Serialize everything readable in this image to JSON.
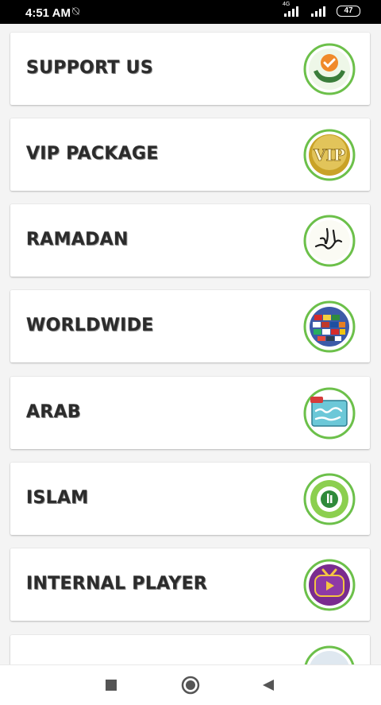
{
  "status_bar": {
    "time": "4:51 AM",
    "network_tag": "4G",
    "battery": "47"
  },
  "menu": {
    "items": [
      {
        "label": "SUPPORT US",
        "icon": "support-check-hands-icon"
      },
      {
        "label": "VIP PACKAGE",
        "icon": "vip-gold-icon"
      },
      {
        "label": "RAMADAN",
        "icon": "ramadan-calligraphy-icon"
      },
      {
        "label": "WORLDWIDE",
        "icon": "world-flags-icon"
      },
      {
        "label": "ARAB",
        "icon": "arab-live-tv-icon"
      },
      {
        "label": "ISLAM",
        "icon": "islam-icon"
      },
      {
        "label": "INTERNAL PLAYER",
        "icon": "tv-play-icon"
      },
      {
        "label": "",
        "icon": "partial-icon"
      }
    ]
  },
  "nav_bar": {
    "buttons": [
      "recents-square-icon",
      "home-circle-icon",
      "back-triangle-icon"
    ]
  },
  "colors": {
    "accent_green": "#6cc04a",
    "status_bar_bg": "#000000",
    "vip_gold": "#c9a227",
    "player_purple": "#7a2c8f"
  }
}
